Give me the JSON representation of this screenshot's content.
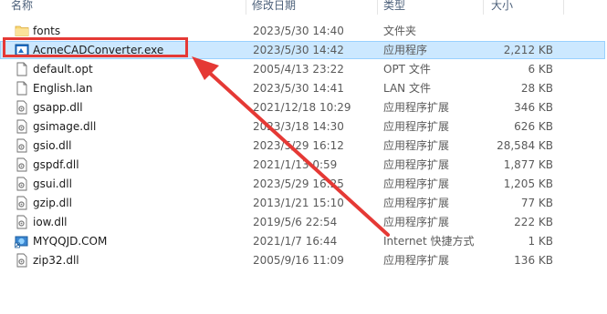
{
  "columns": {
    "name": "名称",
    "date": "修改日期",
    "type": "类型",
    "size": "大小"
  },
  "files": [
    {
      "name": "fonts",
      "date": "2023/5/30 14:40",
      "type": "文件夹",
      "size": "",
      "icon": "folder-icon"
    },
    {
      "name": "AcmeCADConverter.exe",
      "date": "2023/5/30 14:42",
      "type": "应用程序",
      "size": "2,212 KB",
      "icon": "exe-icon",
      "selected": true
    },
    {
      "name": "default.opt",
      "date": "2005/4/13 23:22",
      "type": "OPT 文件",
      "size": "6 KB",
      "icon": "file-icon"
    },
    {
      "name": "English.lan",
      "date": "2023/5/30 14:41",
      "type": "LAN 文件",
      "size": "28 KB",
      "icon": "file-icon"
    },
    {
      "name": "gsapp.dll",
      "date": "2021/12/18 10:29",
      "type": "应用程序扩展",
      "size": "346 KB",
      "icon": "dll-icon"
    },
    {
      "name": "gsimage.dll",
      "date": "2023/3/18 14:30",
      "type": "应用程序扩展",
      "size": "626 KB",
      "icon": "dll-icon"
    },
    {
      "name": "gsio.dll",
      "date": "2023/5/29 16:12",
      "type": "应用程序扩展",
      "size": "28,584 KB",
      "icon": "dll-icon"
    },
    {
      "name": "gspdf.dll",
      "date": "2021/1/13 0:59",
      "type": "应用程序扩展",
      "size": "1,877 KB",
      "icon": "dll-icon"
    },
    {
      "name": "gsui.dll",
      "date": "2023/5/29 16:25",
      "type": "应用程序扩展",
      "size": "1,205 KB",
      "icon": "dll-icon"
    },
    {
      "name": "gzip.dll",
      "date": "2013/1/21 15:10",
      "type": "应用程序扩展",
      "size": "77 KB",
      "icon": "dll-icon"
    },
    {
      "name": "iow.dll",
      "date": "2019/5/6 22:54",
      "type": "应用程序扩展",
      "size": "222 KB",
      "icon": "dll-icon"
    },
    {
      "name": "MYQQJD.COM",
      "date": "2021/1/7 16:44",
      "type": "Internet 快捷方式",
      "size": "1 KB",
      "icon": "internet-shortcut-icon"
    },
    {
      "name": "zip32.dll",
      "date": "2005/9/16 11:09",
      "type": "应用程序扩展",
      "size": "136 KB",
      "icon": "dll-icon"
    }
  ],
  "colors": {
    "selection_bg": "#cce8ff",
    "annotation_red": "#e53935",
    "folder_yellow": "#f8d775"
  }
}
